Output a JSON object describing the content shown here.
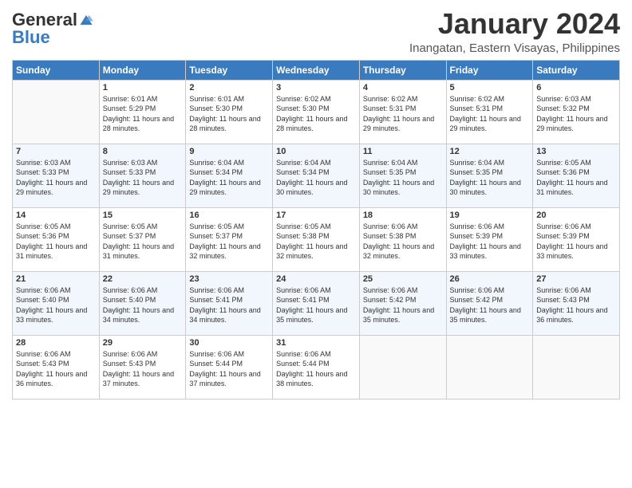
{
  "header": {
    "logo_general": "General",
    "logo_blue": "Blue",
    "month": "January 2024",
    "location": "Inangatan, Eastern Visayas, Philippines"
  },
  "days_of_week": [
    "Sunday",
    "Monday",
    "Tuesday",
    "Wednesday",
    "Thursday",
    "Friday",
    "Saturday"
  ],
  "weeks": [
    [
      {
        "num": "",
        "sunrise": "",
        "sunset": "",
        "daylight": ""
      },
      {
        "num": "1",
        "sunrise": "Sunrise: 6:01 AM",
        "sunset": "Sunset: 5:29 PM",
        "daylight": "Daylight: 11 hours and 28 minutes."
      },
      {
        "num": "2",
        "sunrise": "Sunrise: 6:01 AM",
        "sunset": "Sunset: 5:30 PM",
        "daylight": "Daylight: 11 hours and 28 minutes."
      },
      {
        "num": "3",
        "sunrise": "Sunrise: 6:02 AM",
        "sunset": "Sunset: 5:30 PM",
        "daylight": "Daylight: 11 hours and 28 minutes."
      },
      {
        "num": "4",
        "sunrise": "Sunrise: 6:02 AM",
        "sunset": "Sunset: 5:31 PM",
        "daylight": "Daylight: 11 hours and 29 minutes."
      },
      {
        "num": "5",
        "sunrise": "Sunrise: 6:02 AM",
        "sunset": "Sunset: 5:31 PM",
        "daylight": "Daylight: 11 hours and 29 minutes."
      },
      {
        "num": "6",
        "sunrise": "Sunrise: 6:03 AM",
        "sunset": "Sunset: 5:32 PM",
        "daylight": "Daylight: 11 hours and 29 minutes."
      }
    ],
    [
      {
        "num": "7",
        "sunrise": "Sunrise: 6:03 AM",
        "sunset": "Sunset: 5:33 PM",
        "daylight": "Daylight: 11 hours and 29 minutes."
      },
      {
        "num": "8",
        "sunrise": "Sunrise: 6:03 AM",
        "sunset": "Sunset: 5:33 PM",
        "daylight": "Daylight: 11 hours and 29 minutes."
      },
      {
        "num": "9",
        "sunrise": "Sunrise: 6:04 AM",
        "sunset": "Sunset: 5:34 PM",
        "daylight": "Daylight: 11 hours and 29 minutes."
      },
      {
        "num": "10",
        "sunrise": "Sunrise: 6:04 AM",
        "sunset": "Sunset: 5:34 PM",
        "daylight": "Daylight: 11 hours and 30 minutes."
      },
      {
        "num": "11",
        "sunrise": "Sunrise: 6:04 AM",
        "sunset": "Sunset: 5:35 PM",
        "daylight": "Daylight: 11 hours and 30 minutes."
      },
      {
        "num": "12",
        "sunrise": "Sunrise: 6:04 AM",
        "sunset": "Sunset: 5:35 PM",
        "daylight": "Daylight: 11 hours and 30 minutes."
      },
      {
        "num": "13",
        "sunrise": "Sunrise: 6:05 AM",
        "sunset": "Sunset: 5:36 PM",
        "daylight": "Daylight: 11 hours and 31 minutes."
      }
    ],
    [
      {
        "num": "14",
        "sunrise": "Sunrise: 6:05 AM",
        "sunset": "Sunset: 5:36 PM",
        "daylight": "Daylight: 11 hours and 31 minutes."
      },
      {
        "num": "15",
        "sunrise": "Sunrise: 6:05 AM",
        "sunset": "Sunset: 5:37 PM",
        "daylight": "Daylight: 11 hours and 31 minutes."
      },
      {
        "num": "16",
        "sunrise": "Sunrise: 6:05 AM",
        "sunset": "Sunset: 5:37 PM",
        "daylight": "Daylight: 11 hours and 32 minutes."
      },
      {
        "num": "17",
        "sunrise": "Sunrise: 6:05 AM",
        "sunset": "Sunset: 5:38 PM",
        "daylight": "Daylight: 11 hours and 32 minutes."
      },
      {
        "num": "18",
        "sunrise": "Sunrise: 6:06 AM",
        "sunset": "Sunset: 5:38 PM",
        "daylight": "Daylight: 11 hours and 32 minutes."
      },
      {
        "num": "19",
        "sunrise": "Sunrise: 6:06 AM",
        "sunset": "Sunset: 5:39 PM",
        "daylight": "Daylight: 11 hours and 33 minutes."
      },
      {
        "num": "20",
        "sunrise": "Sunrise: 6:06 AM",
        "sunset": "Sunset: 5:39 PM",
        "daylight": "Daylight: 11 hours and 33 minutes."
      }
    ],
    [
      {
        "num": "21",
        "sunrise": "Sunrise: 6:06 AM",
        "sunset": "Sunset: 5:40 PM",
        "daylight": "Daylight: 11 hours and 33 minutes."
      },
      {
        "num": "22",
        "sunrise": "Sunrise: 6:06 AM",
        "sunset": "Sunset: 5:40 PM",
        "daylight": "Daylight: 11 hours and 34 minutes."
      },
      {
        "num": "23",
        "sunrise": "Sunrise: 6:06 AM",
        "sunset": "Sunset: 5:41 PM",
        "daylight": "Daylight: 11 hours and 34 minutes."
      },
      {
        "num": "24",
        "sunrise": "Sunrise: 6:06 AM",
        "sunset": "Sunset: 5:41 PM",
        "daylight": "Daylight: 11 hours and 35 minutes."
      },
      {
        "num": "25",
        "sunrise": "Sunrise: 6:06 AM",
        "sunset": "Sunset: 5:42 PM",
        "daylight": "Daylight: 11 hours and 35 minutes."
      },
      {
        "num": "26",
        "sunrise": "Sunrise: 6:06 AM",
        "sunset": "Sunset: 5:42 PM",
        "daylight": "Daylight: 11 hours and 35 minutes."
      },
      {
        "num": "27",
        "sunrise": "Sunrise: 6:06 AM",
        "sunset": "Sunset: 5:43 PM",
        "daylight": "Daylight: 11 hours and 36 minutes."
      }
    ],
    [
      {
        "num": "28",
        "sunrise": "Sunrise: 6:06 AM",
        "sunset": "Sunset: 5:43 PM",
        "daylight": "Daylight: 11 hours and 36 minutes."
      },
      {
        "num": "29",
        "sunrise": "Sunrise: 6:06 AM",
        "sunset": "Sunset: 5:43 PM",
        "daylight": "Daylight: 11 hours and 37 minutes."
      },
      {
        "num": "30",
        "sunrise": "Sunrise: 6:06 AM",
        "sunset": "Sunset: 5:44 PM",
        "daylight": "Daylight: 11 hours and 37 minutes."
      },
      {
        "num": "31",
        "sunrise": "Sunrise: 6:06 AM",
        "sunset": "Sunset: 5:44 PM",
        "daylight": "Daylight: 11 hours and 38 minutes."
      },
      {
        "num": "",
        "sunrise": "",
        "sunset": "",
        "daylight": ""
      },
      {
        "num": "",
        "sunrise": "",
        "sunset": "",
        "daylight": ""
      },
      {
        "num": "",
        "sunrise": "",
        "sunset": "",
        "daylight": ""
      }
    ]
  ]
}
